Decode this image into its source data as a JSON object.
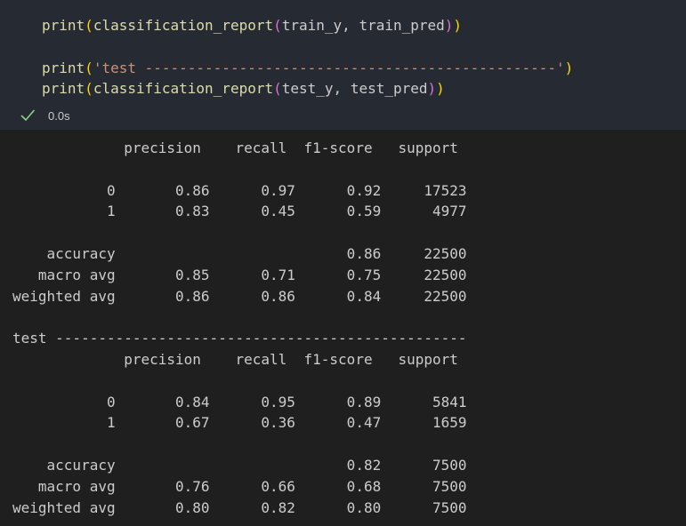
{
  "cell": {
    "code_lines": [
      {
        "fn": "print",
        "open": "(",
        "inner_fn": "classification_report",
        "inner_open": "(",
        "args": "train_y, train_pred",
        "inner_close": ")",
        "close": ")"
      },
      {
        "fn": "print",
        "open": "(",
        "string": "'test ------------------------------------------------'",
        "close": ")"
      },
      {
        "fn": "print",
        "open": "(",
        "inner_fn": "classification_report",
        "inner_open": "(",
        "args": "test_y, test_pred",
        "inner_close": ")",
        "close": ")"
      }
    ],
    "status_icon": "check-icon",
    "status_color": "#89d185",
    "elapsed": "0.0s"
  },
  "output": {
    "lines": [
      "             precision    recall  f1-score   support",
      "",
      "           0       0.86      0.97      0.92     17523",
      "           1       0.83      0.45      0.59      4977",
      "",
      "    accuracy                           0.86     22500",
      "   macro avg       0.85      0.71      0.75     22500",
      "weighted avg       0.86      0.86      0.84     22500",
      "",
      "test ------------------------------------------------",
      "             precision    recall  f1-score   support",
      "",
      "           0       0.84      0.95      0.89      5841",
      "           1       0.67      0.36      0.47      1659",
      "",
      "    accuracy                           0.82      7500",
      "   macro avg       0.76      0.66      0.68      7500",
      "weighted avg       0.80      0.82      0.80      7500"
    ]
  }
}
